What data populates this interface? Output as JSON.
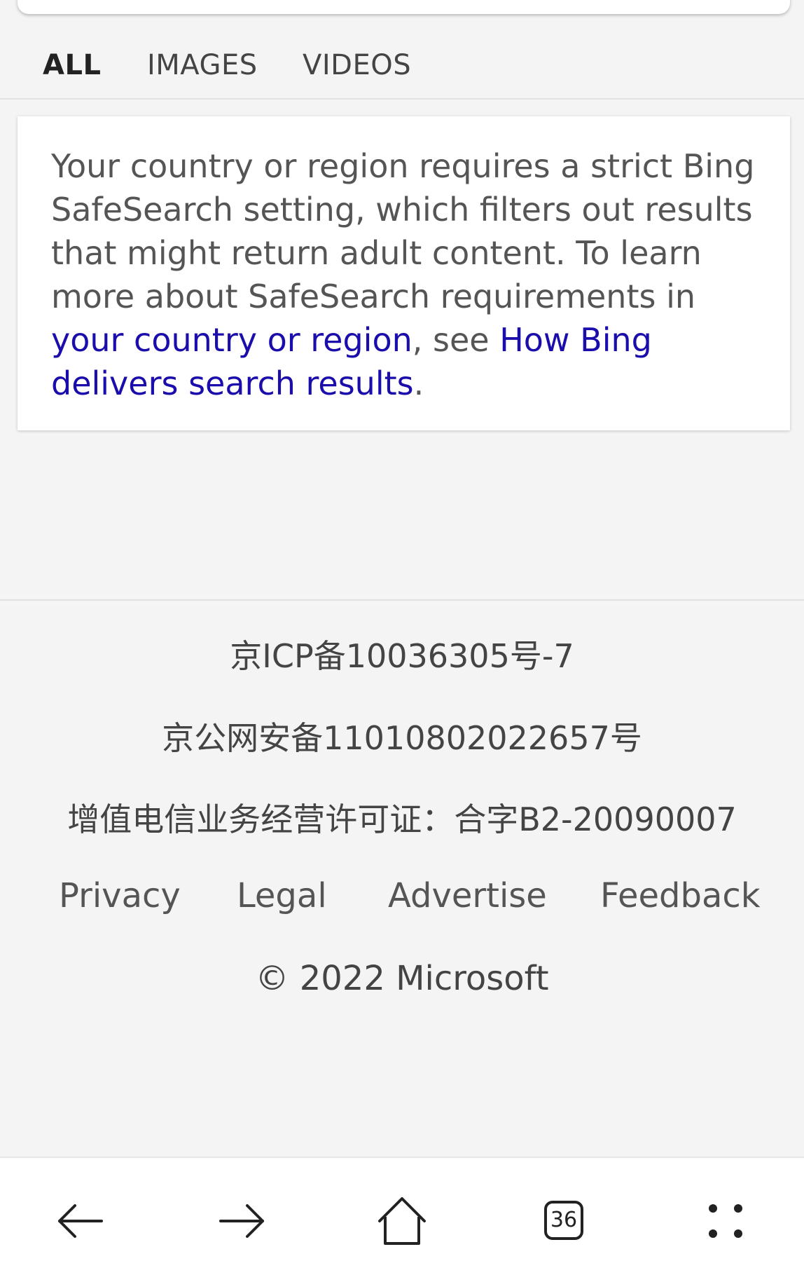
{
  "tabs": {
    "all": "ALL",
    "images": "IMAGES",
    "videos": "VIDEOS"
  },
  "notice": {
    "text_part1": "Your country or region requires a strict Bing SafeSearch setting, which filters out results that might return adult content. To learn more about SafeSearch requirements in ",
    "link_region": "your country or region",
    "text_part2": ", see ",
    "link_delivery": "How Bing delivers search results",
    "text_part3": "."
  },
  "footer": {
    "icp": "京ICP备10036305号-7",
    "psb": "京公网安备11010802022657号",
    "license": "增值电信业务经营许可证：合字B2-20090007",
    "links": {
      "privacy": "Privacy",
      "legal": "Legal",
      "advertise": "Advertise",
      "feedback": "Feedback"
    },
    "copyright": "© 2022 Microsoft"
  },
  "bottom_nav": {
    "tab_count": "36",
    "icons": [
      "back-arrow-icon",
      "forward-arrow-icon",
      "home-icon",
      "tabs-icon",
      "menu-dots-icon"
    ]
  },
  "colors": {
    "link": "#1a0dab",
    "background": "#f4f4f4"
  }
}
